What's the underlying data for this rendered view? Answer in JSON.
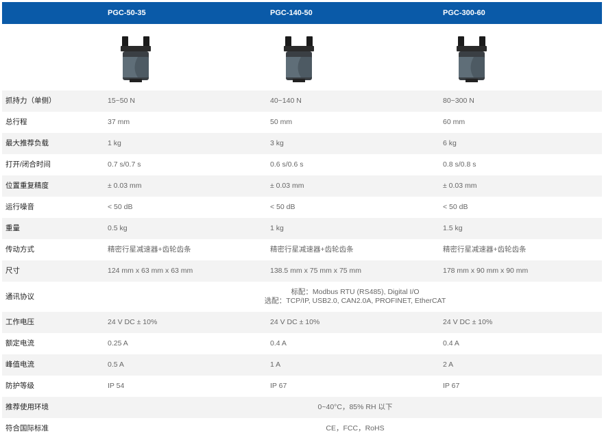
{
  "models": [
    "PGC-50-35",
    "PGC-140-50",
    "PGC-300-60"
  ],
  "rows": [
    {
      "label": "抓持力（单侧）",
      "values": [
        "15~50 N",
        "40~140 N",
        "80~300 N"
      ]
    },
    {
      "label": "总行程",
      "values": [
        "37 mm",
        "50 mm",
        "60 mm"
      ]
    },
    {
      "label": "最大推荐负载",
      "values": [
        "1 kg",
        "3 kg",
        "6 kg"
      ]
    },
    {
      "label": "打开/闭合时间",
      "values": [
        "0.7 s/0.7 s",
        "0.6 s/0.6 s",
        "0.8 s/0.8 s"
      ]
    },
    {
      "label": "位置重复精度",
      "values": [
        "± 0.03 mm",
        "± 0.03 mm",
        "± 0.03 mm"
      ]
    },
    {
      "label": "运行噪音",
      "values": [
        "< 50 dB",
        "< 50 dB",
        "< 50 dB"
      ]
    },
    {
      "label": "重量",
      "values": [
        "0.5 kg",
        "1 kg",
        "1.5 kg"
      ]
    },
    {
      "label": "传动方式",
      "values": [
        "精密行星减速器+齿轮齿条",
        "精密行星减速器+齿轮齿条",
        "精密行星减速器+齿轮齿条"
      ]
    },
    {
      "label": "尺寸",
      "values": [
        "124 mm x 63 mm x 63 mm",
        "138.5 mm x 75 mm x 75 mm",
        "178 mm x 90 mm x 90 mm"
      ]
    }
  ],
  "comm": {
    "label": "通讯协议",
    "line1": "标配：Modbus RTU (RS485), Digital I/O",
    "line2": "选配：TCP/IP, USB2.0, CAN2.0A, PROFINET, EtherCAT"
  },
  "rows2": [
    {
      "label": "工作电压",
      "values": [
        "24 V DC ± 10%",
        "24 V DC ± 10%",
        "24 V DC ± 10%"
      ]
    },
    {
      "label": "额定电流",
      "values": [
        "0.25 A",
        "0.4 A",
        "0.4 A"
      ]
    },
    {
      "label": "峰值电流",
      "values": [
        "0.5 A",
        "1 A",
        "2 A"
      ]
    },
    {
      "label": "防护等级",
      "values": [
        "IP 54",
        "IP 67",
        "IP 67"
      ]
    }
  ],
  "env": {
    "label": "推荐使用环境",
    "value": "0~40°C，85% RH 以下"
  },
  "std": {
    "label": "符合国际标准",
    "value": "CE，FCC，RoHS"
  },
  "colors": {
    "header_bg": "#0a5aa8",
    "row_shade": "#f3f3f3"
  }
}
